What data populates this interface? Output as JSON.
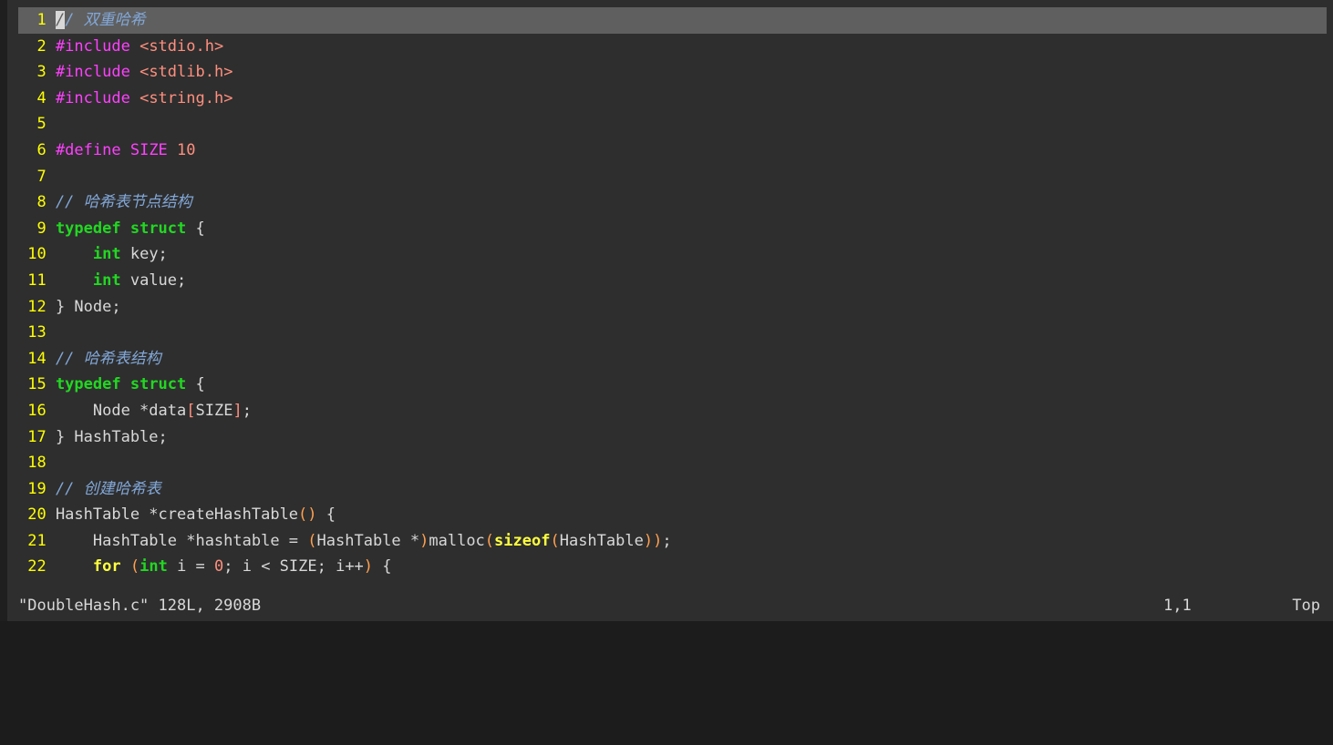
{
  "editor": {
    "name": "vim",
    "background_color": "#2e2e2e",
    "cursorline_color": "#5f5f5f",
    "cursor": {
      "char": "/",
      "line": 1,
      "column": 1
    },
    "lines": [
      {
        "number": "1",
        "cursorline": true,
        "tokens": [
          {
            "text": "/",
            "class": "tok-comment cursor-block"
          },
          {
            "text": "/ 双重哈希",
            "class": "tok-comment"
          }
        ]
      },
      {
        "number": "2",
        "cursorline": false,
        "tokens": [
          {
            "text": "#include",
            "class": "tok-pre"
          },
          {
            "text": " ",
            "class": "tok-plain"
          },
          {
            "text": "<stdio.h>",
            "class": "tok-string"
          }
        ]
      },
      {
        "number": "3",
        "cursorline": false,
        "tokens": [
          {
            "text": "#include",
            "class": "tok-pre"
          },
          {
            "text": " ",
            "class": "tok-plain"
          },
          {
            "text": "<stdlib.h>",
            "class": "tok-string"
          }
        ]
      },
      {
        "number": "4",
        "cursorline": false,
        "tokens": [
          {
            "text": "#include",
            "class": "tok-pre"
          },
          {
            "text": " ",
            "class": "tok-plain"
          },
          {
            "text": "<string.h>",
            "class": "tok-string"
          }
        ]
      },
      {
        "number": "5",
        "cursorline": false,
        "tokens": []
      },
      {
        "number": "6",
        "cursorline": false,
        "tokens": [
          {
            "text": "#define",
            "class": "tok-pre"
          },
          {
            "text": " ",
            "class": "tok-plain"
          },
          {
            "text": "SIZE",
            "class": "tok-preid"
          },
          {
            "text": " ",
            "class": "tok-plain"
          },
          {
            "text": "10",
            "class": "tok-number"
          }
        ]
      },
      {
        "number": "7",
        "cursorline": false,
        "tokens": []
      },
      {
        "number": "8",
        "cursorline": false,
        "tokens": [
          {
            "text": "// 哈希表节点结构",
            "class": "tok-comment"
          }
        ]
      },
      {
        "number": "9",
        "cursorline": false,
        "tokens": [
          {
            "text": "typedef",
            "class": "tok-keyword"
          },
          {
            "text": " ",
            "class": "tok-plain"
          },
          {
            "text": "struct",
            "class": "tok-keyword"
          },
          {
            "text": " ",
            "class": "tok-plain"
          },
          {
            "text": "{",
            "class": "tok-plain"
          }
        ]
      },
      {
        "number": "10",
        "cursorline": false,
        "tokens": [
          {
            "text": "    ",
            "class": "tok-plain"
          },
          {
            "text": "int",
            "class": "tok-type"
          },
          {
            "text": " key;",
            "class": "tok-plain"
          }
        ]
      },
      {
        "number": "11",
        "cursorline": false,
        "tokens": [
          {
            "text": "    ",
            "class": "tok-plain"
          },
          {
            "text": "int",
            "class": "tok-type"
          },
          {
            "text": " value;",
            "class": "tok-plain"
          }
        ]
      },
      {
        "number": "12",
        "cursorline": false,
        "tokens": [
          {
            "text": "} Node;",
            "class": "tok-plain"
          }
        ]
      },
      {
        "number": "13",
        "cursorline": false,
        "tokens": []
      },
      {
        "number": "14",
        "cursorline": false,
        "tokens": [
          {
            "text": "// 哈希表结构",
            "class": "tok-comment"
          }
        ]
      },
      {
        "number": "15",
        "cursorline": false,
        "tokens": [
          {
            "text": "typedef",
            "class": "tok-keyword"
          },
          {
            "text": " ",
            "class": "tok-plain"
          },
          {
            "text": "struct",
            "class": "tok-keyword"
          },
          {
            "text": " ",
            "class": "tok-plain"
          },
          {
            "text": "{",
            "class": "tok-plain"
          }
        ]
      },
      {
        "number": "16",
        "cursorline": false,
        "tokens": [
          {
            "text": "    Node *data",
            "class": "tok-plain"
          },
          {
            "text": "[",
            "class": "tok-bracket"
          },
          {
            "text": "SIZE",
            "class": "tok-plain"
          },
          {
            "text": "]",
            "class": "tok-bracket"
          },
          {
            "text": ";",
            "class": "tok-plain"
          }
        ]
      },
      {
        "number": "17",
        "cursorline": false,
        "tokens": [
          {
            "text": "} HashTable;",
            "class": "tok-plain"
          }
        ]
      },
      {
        "number": "18",
        "cursorline": false,
        "tokens": []
      },
      {
        "number": "19",
        "cursorline": false,
        "tokens": [
          {
            "text": "// 创建哈希表",
            "class": "tok-comment"
          }
        ]
      },
      {
        "number": "20",
        "cursorline": false,
        "tokens": [
          {
            "text": "HashTable *createHashTable",
            "class": "tok-plain"
          },
          {
            "text": "()",
            "class": "tok-paren"
          },
          {
            "text": " {",
            "class": "tok-plain"
          }
        ]
      },
      {
        "number": "21",
        "cursorline": false,
        "tokens": [
          {
            "text": "    HashTable *hashtable = ",
            "class": "tok-plain"
          },
          {
            "text": "(",
            "class": "tok-paren"
          },
          {
            "text": "HashTable *",
            "class": "tok-plain"
          },
          {
            "text": ")",
            "class": "tok-paren"
          },
          {
            "text": "malloc",
            "class": "tok-plain"
          },
          {
            "text": "(",
            "class": "tok-paren"
          },
          {
            "text": "sizeof",
            "class": "tok-statement"
          },
          {
            "text": "(",
            "class": "tok-paren"
          },
          {
            "text": "HashTable",
            "class": "tok-plain"
          },
          {
            "text": "))",
            "class": "tok-paren"
          },
          {
            "text": ";",
            "class": "tok-plain"
          }
        ]
      },
      {
        "number": "22",
        "cursorline": false,
        "tokens": [
          {
            "text": "    ",
            "class": "tok-plain"
          },
          {
            "text": "for",
            "class": "tok-statement"
          },
          {
            "text": " ",
            "class": "tok-plain"
          },
          {
            "text": "(",
            "class": "tok-paren"
          },
          {
            "text": "int",
            "class": "tok-type"
          },
          {
            "text": " i = ",
            "class": "tok-plain"
          },
          {
            "text": "0",
            "class": "tok-number"
          },
          {
            "text": "; i < SIZE; i++",
            "class": "tok-plain"
          },
          {
            "text": ")",
            "class": "tok-paren"
          },
          {
            "text": " {",
            "class": "tok-plain"
          }
        ]
      }
    ]
  },
  "statusline": {
    "file_info": "\"DoubleHash.c\" 128L, 2908B",
    "filename": "DoubleHash.c",
    "line_count": "128L",
    "byte_count": "2908B",
    "position": "1,1",
    "scroll_position": "Top"
  }
}
